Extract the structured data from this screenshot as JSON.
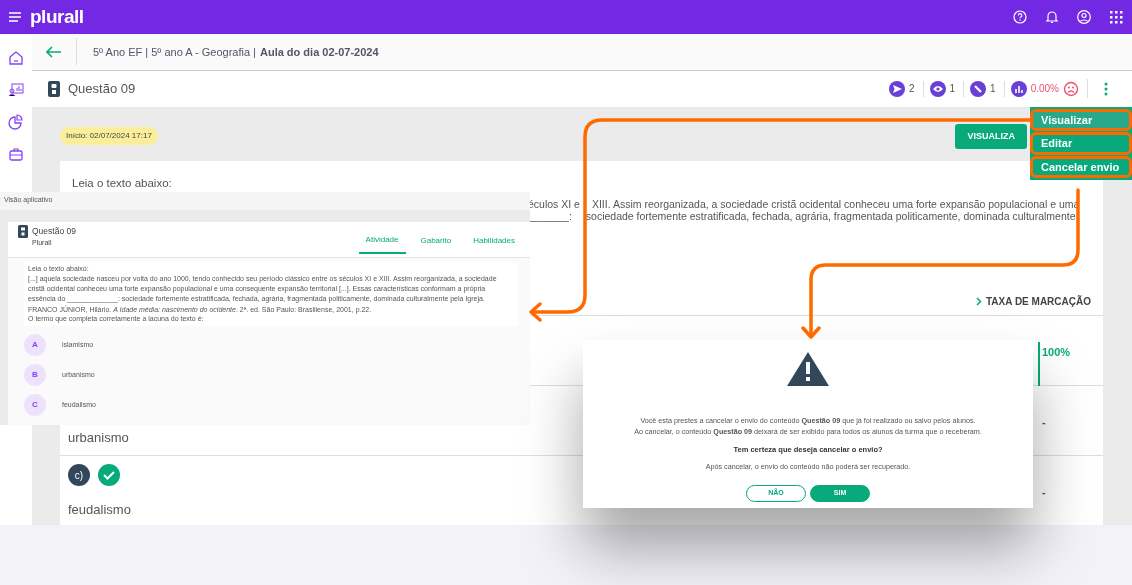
{
  "top_bar": {
    "logo": "plurall"
  },
  "breadcrumb": {
    "path": "5º Ano EF | 5º ano A - Geografia |",
    "current": "Aula do dia 02-07-2024"
  },
  "question": {
    "title": "Questão 09",
    "stats": [
      {
        "kind": "sent",
        "value": "2"
      },
      {
        "kind": "viewed",
        "value": "1"
      },
      {
        "kind": "corrected",
        "value": "1"
      },
      {
        "kind": "rate",
        "value": "0.00%"
      }
    ]
  },
  "start_badge": "Início: 02/07/2024 17:17",
  "view_button": "VISUALIZA",
  "card": {
    "intro": "Leia o texto abaixo:",
    "line_start": "éculos XI e",
    "line": "XIII. Assim reorganizada, a sociedade cristã ocidental conheceu uma forte expansão populacional e uma",
    "blank": "_______:",
    "rest": "sociedade fortemente estratificada, fechada, agrária, fragmentada politicamente, dominada culturalmente"
  },
  "rate_link": "TAXA DE MARCAÇÃO",
  "answers": [
    {
      "rate": "100%",
      "highlighted": true
    },
    {
      "text": "urbanismo",
      "rate": "-",
      "highlighted": false
    },
    {
      "letter": "c)",
      "correct": true,
      "text": "feudalismo",
      "rate": "-",
      "highlighted": false
    }
  ],
  "menu": [
    {
      "label": "Visualizar",
      "selected": true
    },
    {
      "label": "Editar",
      "selected": false
    },
    {
      "label": "Cancelar envio",
      "selected": false
    }
  ],
  "app_preview": {
    "label": "Visão aplicativo",
    "title": "Questão 09",
    "subtitle": "Plurall",
    "tabs": [
      {
        "label": "Atividade",
        "selected": true
      },
      {
        "label": "Gabarito",
        "selected": false
      },
      {
        "label": "Habilidades",
        "selected": false
      }
    ],
    "intro": "Leia o texto abaixo:",
    "passage": "[...] aquela sociedade nasceu por volta do ano 1000, tendo conhecido seu período clássico entre os séculos XI e XIII. Assim reorganizada, a sociedade cristã ocidental conheceu uma forte expansão populacional e uma consequente expansão territorial [...]. Essas características conformam a própria essência do _____________: sociedade fortemente estratificada, fechada, agrária, fragmentada politicamente, dominada culturalmente pela Igreja.",
    "source": "FRANCO JÚNIOR, Hilário. *A Idade média: nascimento do ocidente*. 2ª. ed. São Paulo: Brasiliense, 2001, p.22.",
    "prompt": "O termo que completa corretamente a lacuna do texto é:",
    "options": [
      {
        "letter": "A",
        "text": "islamismo"
      },
      {
        "letter": "B",
        "text": "urbanismo"
      },
      {
        "letter": "C",
        "text": "feudalismo"
      }
    ]
  },
  "modal": {
    "lines": [
      "Você esta prestes a cancelar o envio do conteúdo **Questão 09** que já foi realizado ou salvo pelos alunos.",
      "Ao cancelar, o conteúdo **Questão 09** deixará de ser exibido para todos os alunos da turma que o receberam."
    ],
    "question": "Tem certeza que deseja cancelar o envio?",
    "note": "Após cancelar, o envio do conteúdo não poderá ser recuperado.",
    "buttons": [
      {
        "label": "NÃO",
        "kind": "outline"
      },
      {
        "label": "SIM",
        "kind": "solid"
      }
    ]
  }
}
